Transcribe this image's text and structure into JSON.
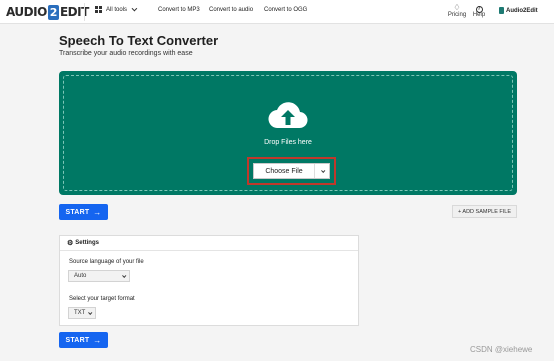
{
  "header": {
    "logo_left": "AUDIO",
    "logo_mid": "2",
    "logo_right": "EDIT",
    "all_tools": "All tools",
    "links": [
      "Convert to MP3",
      "Convert to audio",
      "Convert to OGG"
    ],
    "pricing": "Pricing",
    "help": "Help",
    "account": "Audio2Edit"
  },
  "page": {
    "title": "Speech To Text Converter",
    "subtitle": "Transcribe your audio recordings with ease"
  },
  "upload": {
    "drop_text": "Drop Files here",
    "choose_file": "Choose File"
  },
  "actions": {
    "start": "START",
    "add_sample": "+ ADD SAMPLE FILE"
  },
  "settings": {
    "title": "Settings",
    "source_label": "Source language of your file",
    "source_value": "Auto",
    "target_label": "Select your target format",
    "target_value": "TXT"
  },
  "watermark": "CSDN @xiehewe",
  "colors": {
    "brand_teal": "#007864",
    "start_blue": "#1565f0",
    "highlight_red": "#c0382b"
  }
}
